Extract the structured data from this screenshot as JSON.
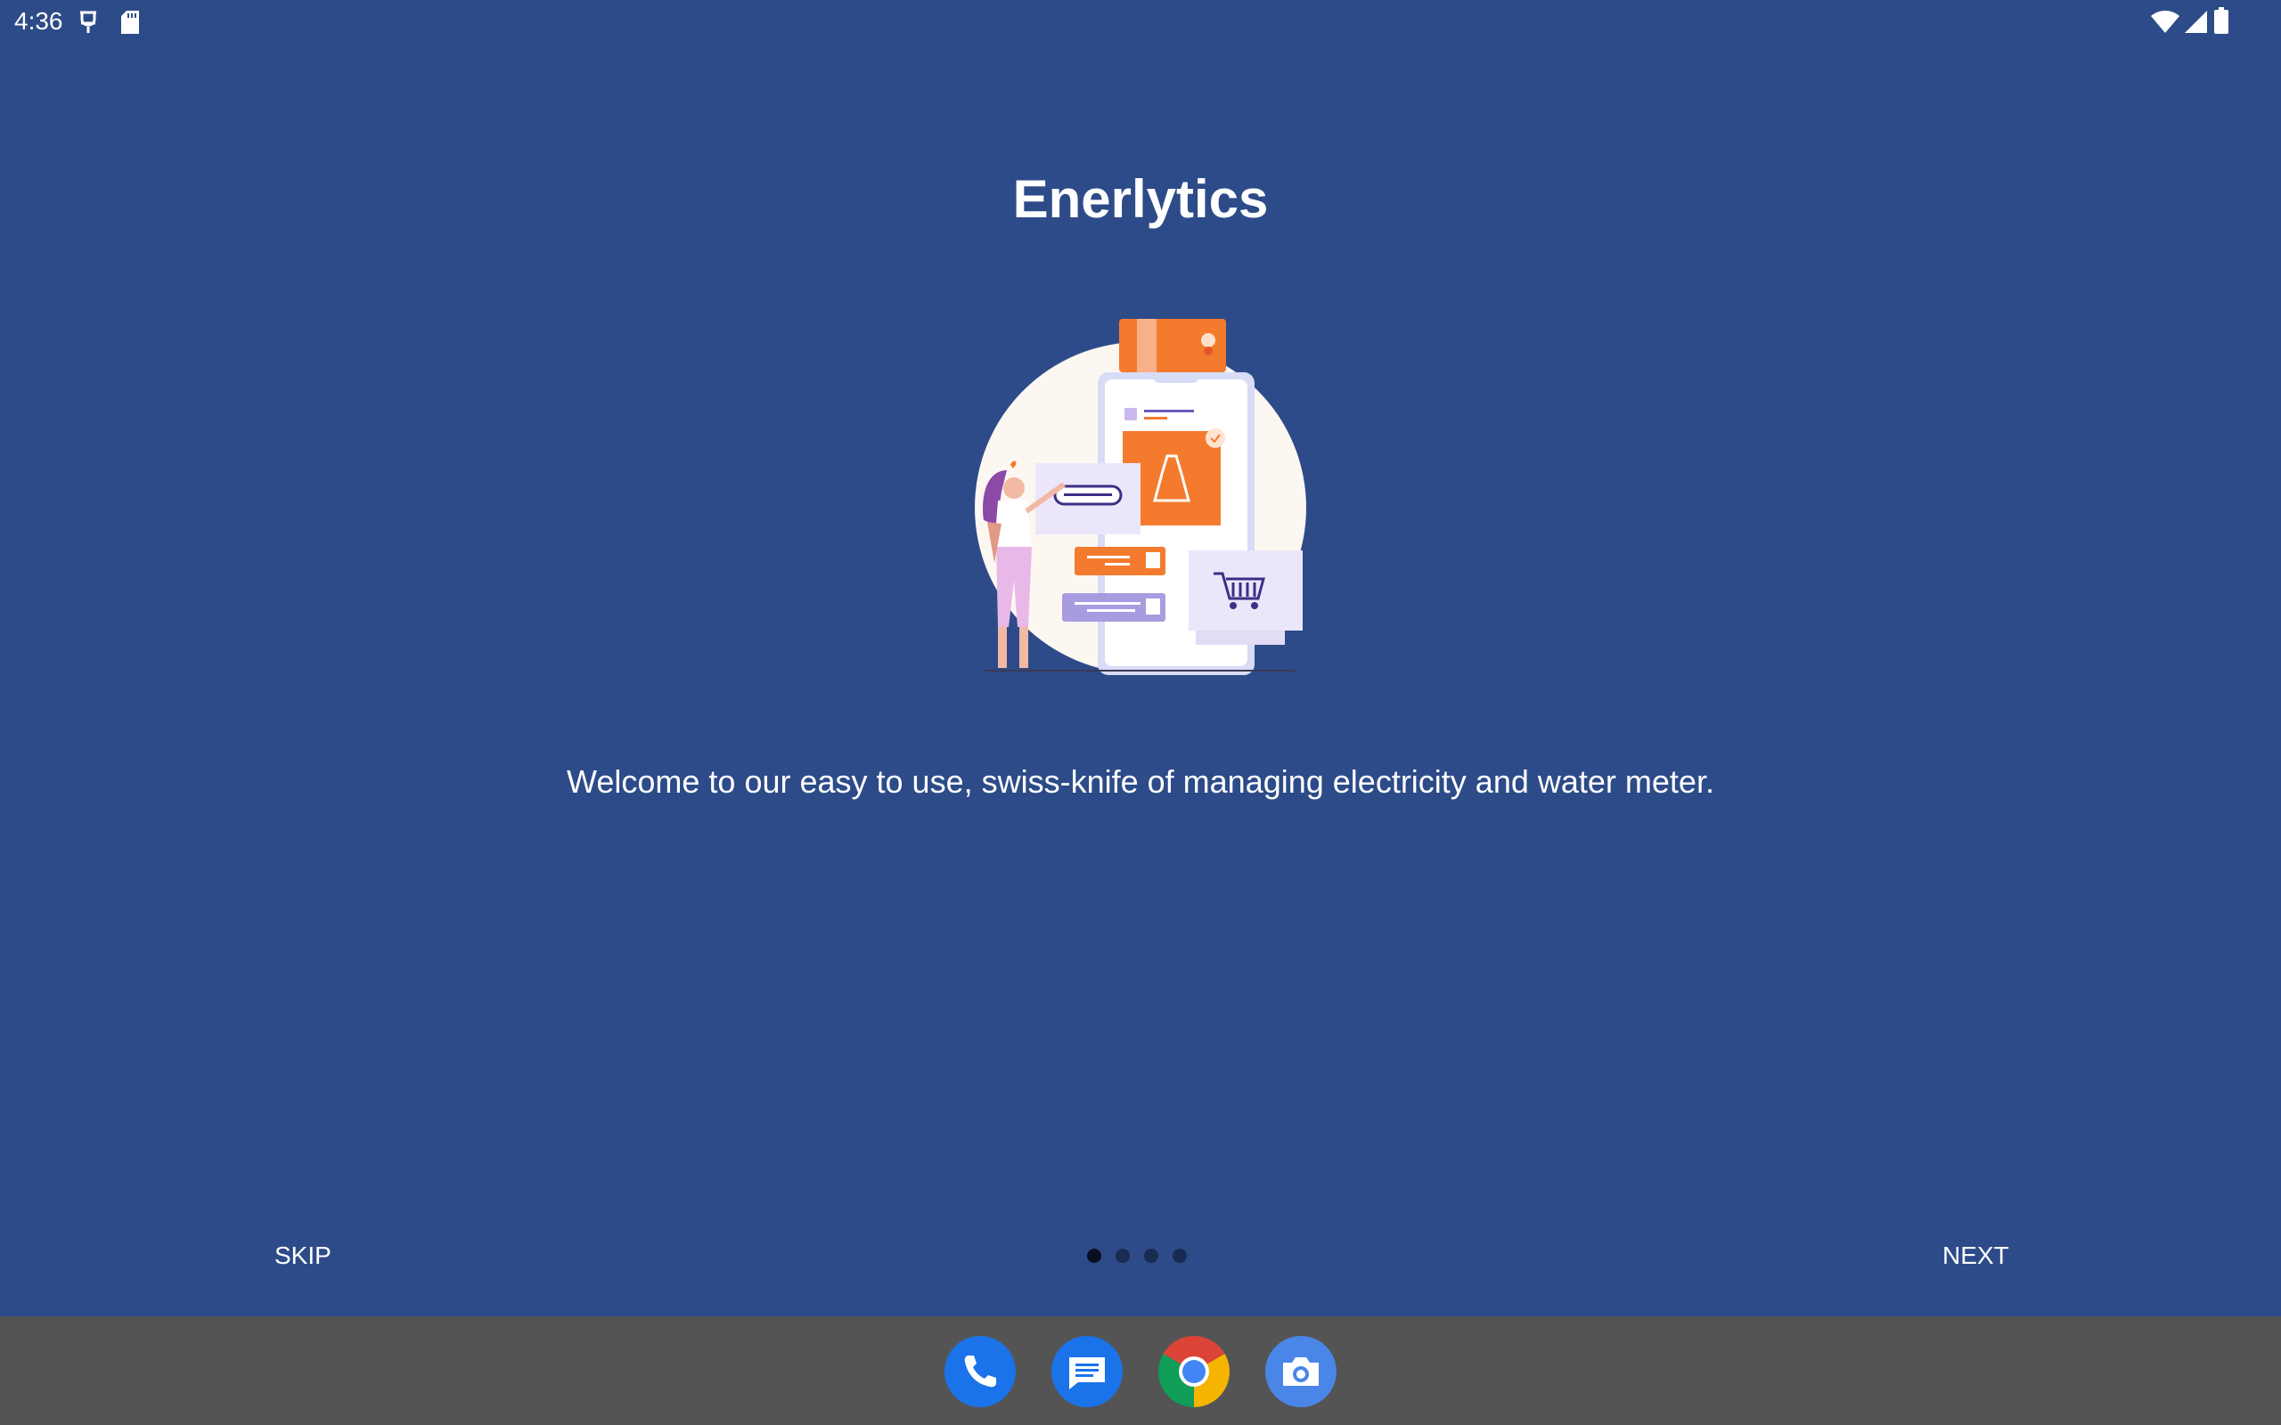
{
  "status_bar": {
    "time": "4:36",
    "left_icons": [
      "vpn-key-icon",
      "sd-card-icon"
    ],
    "right_icons": [
      "wifi-icon",
      "cell-signal-icon",
      "battery-icon"
    ]
  },
  "onboarding": {
    "title": "Enerlytics",
    "illustration": "shopping-app-illustration",
    "description": "Welcome to our easy to use, swiss-knife of managing electricity and water meter.",
    "skip_label": "SKIP",
    "next_label": "NEXT",
    "page_indicator": {
      "total": 4,
      "current": 1
    }
  },
  "taskbar": {
    "apps": [
      "phone-app-icon",
      "messages-app-icon",
      "chrome-app-icon",
      "camera-app-icon"
    ]
  },
  "colors": {
    "background": "#2d4b88",
    "taskbar": "#545455",
    "accent_orange": "#f47b2e",
    "illustration_circle": "#fdf7f2"
  }
}
